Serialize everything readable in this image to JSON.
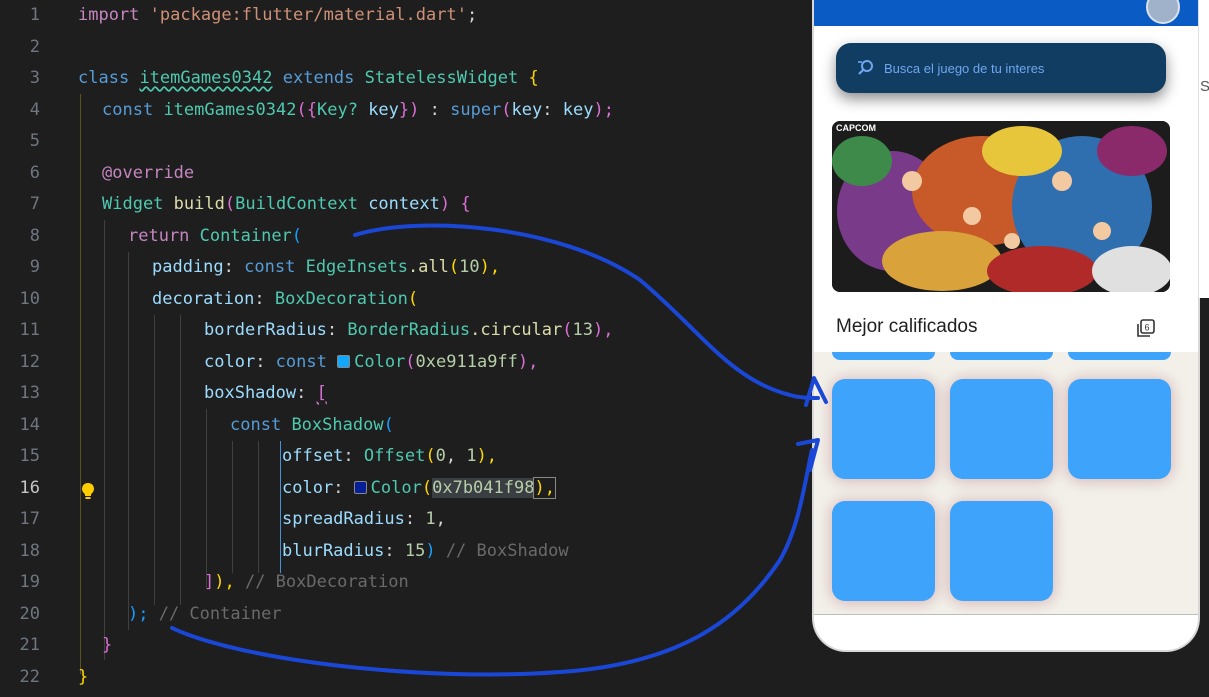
{
  "editor": {
    "line_numbers": [
      "1",
      "2",
      "3",
      "4",
      "5",
      "6",
      "7",
      "8",
      "9",
      "10",
      "11",
      "12",
      "13",
      "14",
      "15",
      "16",
      "17",
      "18",
      "19",
      "20",
      "21",
      "22"
    ],
    "active_line": "16",
    "code": {
      "l1_kw": "import",
      "l1_str": "'package:flutter/material.dart'",
      "l1_end": ";",
      "l3_class": "class",
      "l3_name": "itemGames0342",
      "l3_extends": "extends",
      "l3_parent": "StatelessWidget",
      "l3_brace": "{",
      "l4_const": "const",
      "l4_name": "itemGames0342",
      "l4_args1": "({",
      "l4_type": "Key?",
      "l4_key": "key",
      "l4_args2": "})",
      "l4_colon": " : ",
      "l4_super": "super",
      "l4_p1": "(",
      "l4_label": "key",
      "l4_colon2": ": ",
      "l4_key2": "key",
      "l4_p2": ");",
      "l6_override": "@override",
      "l7_type": "Widget",
      "l7_fn": "build",
      "l7_p1": "(",
      "l7_ctype": "BuildContext",
      "l7_ctx": "context",
      "l7_p2": ")",
      "l7_brace": "{",
      "l8_return": "return",
      "l8_widget": "Container",
      "l8_p": "(",
      "l9_prop": "padding",
      "l9_colon": ": ",
      "l9_const": "const",
      "l9_type": "EdgeInsets",
      "l9_fn": ".all",
      "l9_p1": "(",
      "l9_num": "10",
      "l9_p2": "),",
      "l10_prop": "decoration",
      "l10_colon": ": ",
      "l10_type": "BoxDecoration",
      "l10_p": "(",
      "l11_prop": "borderRadius",
      "l11_colon": ": ",
      "l11_type": "BorderRadius",
      "l11_fn": ".circular",
      "l11_p1": "(",
      "l11_num": "13",
      "l11_p2": "),",
      "l12_prop": "color",
      "l12_colon": ": ",
      "l12_const": "const",
      "l12_type": "Color",
      "l12_p1": "(",
      "l12_num": "0xe911a9ff",
      "l12_p2": "),",
      "l13_prop": "boxShadow",
      "l13_colon": ": ",
      "l13_br": "[",
      "l14_const": "const",
      "l14_type": "BoxShadow",
      "l14_p": "(",
      "l15_prop": "offset",
      "l15_colon": ": ",
      "l15_type": "Offset",
      "l15_p1": "(",
      "l15_num1": "0",
      "l15_comma": ", ",
      "l15_num2": "1",
      "l15_p2": "),",
      "l16_prop": "color",
      "l16_colon": ": ",
      "l16_type": "Color",
      "l16_p1": "(",
      "l16_num": "0x7b041f98",
      "l16_p2": "),",
      "l17_prop": "spreadRadius",
      "l17_colon": ": ",
      "l17_num": "1",
      "l17_comma": ",",
      "l18_prop": "blurRadius",
      "l18_colon": ": ",
      "l18_num": "15",
      "l18_p": ")",
      "l18_comment": " // BoxShadow",
      "l19_close": "]",
      "l19_p": "),",
      "l19_comment": " // BoxDecoration",
      "l20_close": ");",
      "l20_comment": " // Container",
      "l21_brace": "}",
      "l22_brace": "}"
    },
    "swatch_colors": {
      "color_a": "#11a9ff",
      "color_b": "#041f98"
    }
  },
  "phone": {
    "search_placeholder": "Busca el juego de tu interes",
    "section_title": "Mejor calificados",
    "tile_color": "#3ea3fa",
    "tile_count": 5,
    "appbar_color": "#0a5bc4",
    "search_bg": "#113d63",
    "banner_logo": "CAPCOM"
  },
  "side_panel": {
    "text": "S"
  },
  "colors": {
    "editor_bg": "#1e1e1e",
    "arrow": "#1a47d6"
  }
}
